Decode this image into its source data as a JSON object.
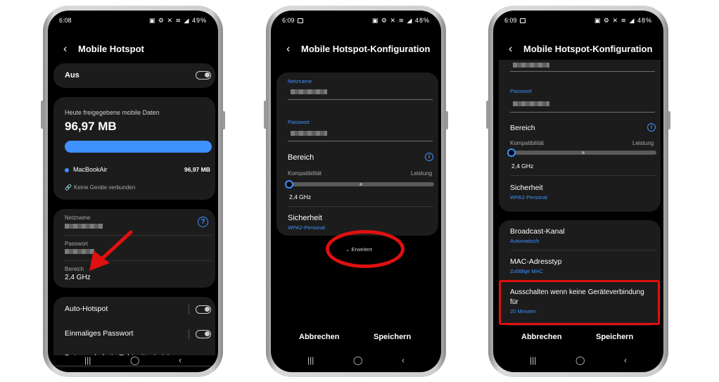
{
  "status_bar": [
    {
      "time": "6:08",
      "battery": "49%"
    },
    {
      "time": "6:09",
      "battery": "48%"
    },
    {
      "time": "6:09",
      "battery": "48%"
    }
  ],
  "phone1": {
    "title": "Mobile Hotspot",
    "hotspot_toggle_label": "Aus",
    "data_usage": {
      "label": "Heute freigegebene mobile Daten",
      "amount": "96,97 MB",
      "progress_fraction": 1.0,
      "device_name": "MacBookAir",
      "device_amount": "96,97 MB",
      "no_devices": "Keine Geräte verbunden"
    },
    "network_name_label": "Netzname",
    "password_label": "Passwort",
    "band_label": "Bereich",
    "band_value": "2,4 GHz",
    "auto_hotspot_label": "Auto-Hotspot",
    "one_time_password_label": "Einmaliges Passwort",
    "cut_off_label": "Datenverkehr in Echtzeit priorisieren"
  },
  "phone2": {
    "title": "Mobile Hotspot-Konfiguration",
    "network_name_label": "Netzname",
    "password_label": "Passwort",
    "band_label": "Bereich",
    "band_left": "Kompatibilität",
    "band_right": "Leistung",
    "band_value": "2,4 GHz",
    "security_label": "Sicherheit",
    "security_value": "WPA2-Personal",
    "advanced_label": "Erweitert",
    "cancel_label": "Abbrechen",
    "save_label": "Speichern"
  },
  "phone3": {
    "title": "Mobile Hotspot-Konfiguration",
    "password_label": "Passwort",
    "band_label": "Bereich",
    "band_left": "Kompatibilität",
    "band_right": "Leistung",
    "band_value": "2,4 GHz",
    "security_label": "Sicherheit",
    "security_value": "WPA2-Personal",
    "broadcast_label": "Broadcast-Kanal",
    "broadcast_value": "Automatisch",
    "mac_label": "MAC-Adresstyp",
    "mac_value": "Zufällige MAC",
    "timeout_label_line1": "Ausschalten wenn keine Geräteverbindung",
    "timeout_label_line2": "für",
    "timeout_value": "20 Minuten",
    "cancel_label": "Abbrechen",
    "save_label": "Speichern"
  },
  "nav_icons": [
    "recent-apps-icon",
    "home-icon",
    "back-icon"
  ],
  "colors": {
    "accent": "#3e91ff",
    "highlight": "#e01010",
    "card": "#1c1c1c"
  }
}
